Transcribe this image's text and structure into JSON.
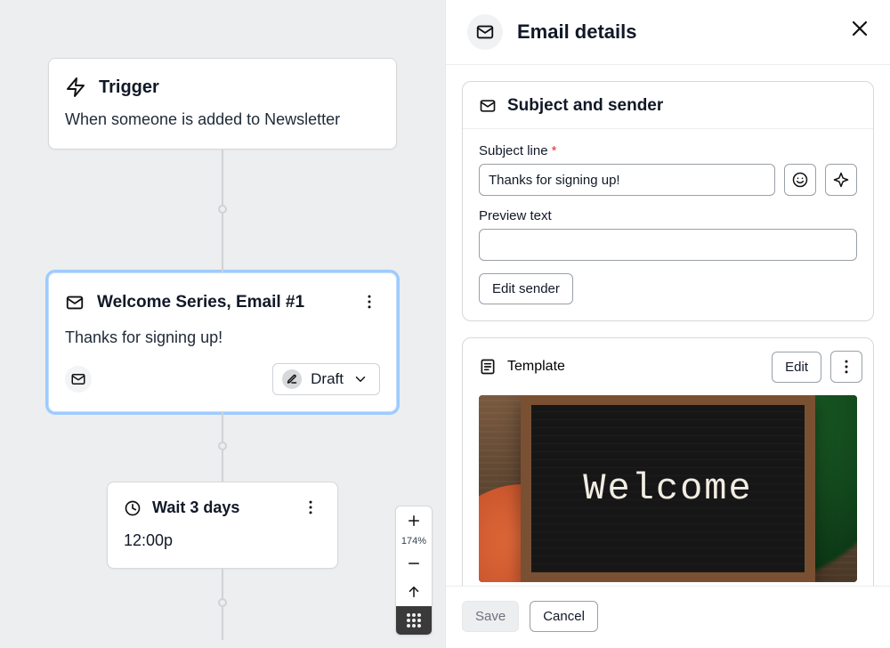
{
  "canvas": {
    "trigger": {
      "title": "Trigger",
      "description": "When someone is added to Newsletter"
    },
    "email": {
      "title": "Welcome Series, Email #1",
      "preview_line": "Thanks for signing up!",
      "status_label": "Draft"
    },
    "wait": {
      "title": "Wait 3 days",
      "time": "12:00p"
    },
    "zoom_label": "174%"
  },
  "panel": {
    "title": "Email details",
    "subject_section": {
      "title": "Subject and sender",
      "subject_label": "Subject line",
      "subject_value": "Thanks for signing up!",
      "preview_label": "Preview text",
      "preview_value": "",
      "edit_sender_label": "Edit sender"
    },
    "template_section": {
      "title": "Template",
      "edit_label": "Edit",
      "banner_text": "Welcome"
    },
    "footer": {
      "save_label": "Save",
      "cancel_label": "Cancel"
    }
  }
}
